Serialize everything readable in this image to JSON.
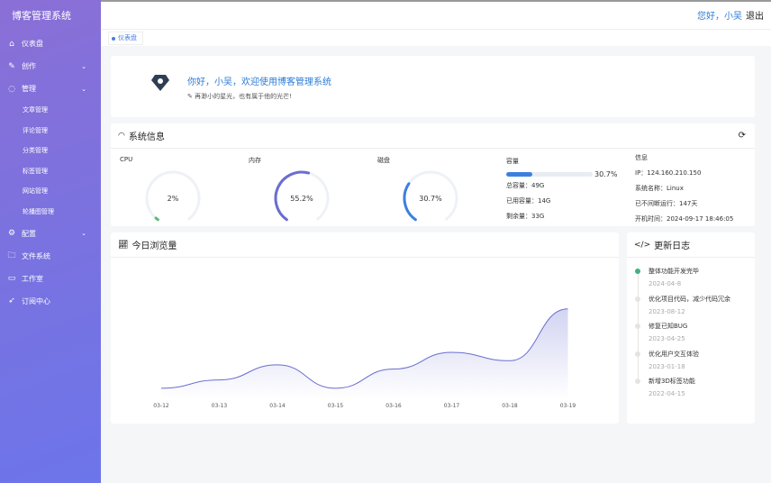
{
  "sidebar": {
    "title": "博客管理系统",
    "items": [
      {
        "label": "仪表盘",
        "icon": "home-icon"
      },
      {
        "label": "创作",
        "icon": "edit-icon"
      },
      {
        "label": "管理",
        "icon": "manage-icon"
      }
    ],
    "sub": [
      "文章管理",
      "评论管理",
      "分类管理",
      "标签管理",
      "网站管理",
      "轮播图管理"
    ],
    "items2": [
      {
        "label": "配置",
        "icon": "gear-icon"
      },
      {
        "label": "文件系统",
        "icon": "folder-icon"
      },
      {
        "label": "工作室",
        "icon": "monitor-icon"
      },
      {
        "label": "订阅中心",
        "icon": "send-icon"
      }
    ]
  },
  "topbar": {
    "greeting": "您好，小吴",
    "logout": "退出"
  },
  "tags": {
    "active": "仪表盘"
  },
  "welcome": {
    "title": "你好，小吴，欢迎使用博客管理系统",
    "subtitle": "再渺小的星光，也有属于他的光芒!"
  },
  "system": {
    "title": "系统信息",
    "cpu": {
      "label": "CPU",
      "value": "2%",
      "percent": 2,
      "color": "#5fb878"
    },
    "mem": {
      "label": "内存",
      "value": "55.2%",
      "percent": 55.2,
      "color": "#6a6ed0"
    },
    "disk": {
      "label": "磁盘",
      "value": "30.7%",
      "percent": 30.7,
      "color": "#3c7fe0"
    },
    "capacity": {
      "label": "容量",
      "percent_text": "30.7%",
      "percent": 30.7,
      "total": "总容量：49G",
      "used": "已用容量：14G",
      "free": "剩余量：33G"
    },
    "info": {
      "label": "信息",
      "ip": "IP：124.160.210.150",
      "os": "系统名称：Linux",
      "uptime": "已不间断运行：147天",
      "boot": "开机时间：2024-09-17 18:46:05"
    }
  },
  "chart_data": {
    "type": "area",
    "title": "今日浏览量",
    "categories": [
      "03-12",
      "03-13",
      "03-14",
      "03-15",
      "03-16",
      "03-17",
      "03-18",
      "03-19"
    ],
    "values": [
      12,
      22,
      40,
      12,
      35,
      55,
      45,
      107
    ],
    "ylim": [
      0,
      110
    ],
    "color": "#6a6ed0"
  },
  "log": {
    "title": "更新日志",
    "items": [
      {
        "text": "整体功能开发完毕",
        "date": "2024-04-8"
      },
      {
        "text": "优化项目代码，减少代码冗余",
        "date": "2023-08-12"
      },
      {
        "text": "修复已知BUG",
        "date": "2023-04-25"
      },
      {
        "text": "优化用户交互体验",
        "date": "2023-01-18"
      },
      {
        "text": "新增3D标签功能",
        "date": "2022-04-15"
      }
    ]
  }
}
